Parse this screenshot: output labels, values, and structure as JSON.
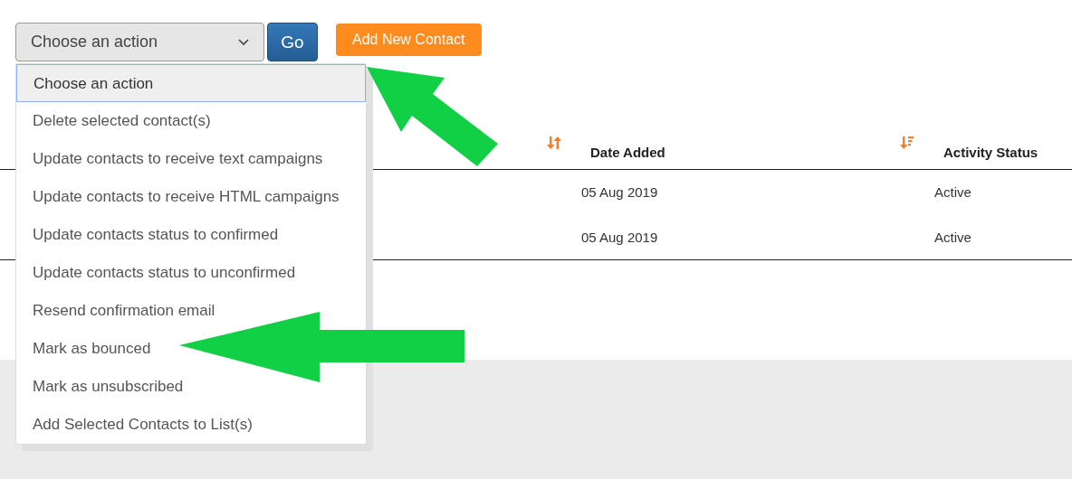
{
  "toolbar": {
    "action_select": {
      "value": "Choose an action",
      "expanded": true,
      "options": [
        {
          "label": "Choose an action",
          "selected": true
        },
        {
          "label": "Delete selected contact(s)",
          "selected": false
        },
        {
          "label": "Update contacts to receive text campaigns",
          "selected": false
        },
        {
          "label": "Update contacts to receive HTML campaigns",
          "selected": false
        },
        {
          "label": "Update contacts status to confirmed",
          "selected": false
        },
        {
          "label": "Update contacts status to unconfirmed",
          "selected": false
        },
        {
          "label": "Resend confirmation email",
          "selected": false
        },
        {
          "label": "Mark as bounced",
          "selected": false
        },
        {
          "label": "Mark as unsubscribed",
          "selected": false
        },
        {
          "label": "Add Selected Contacts to List(s)",
          "selected": false
        }
      ]
    },
    "go_button": "Go",
    "add_button": "Add New Contact"
  },
  "table": {
    "columns": [
      {
        "label": "Date Added",
        "sort_descending": false
      },
      {
        "label": "Activity Status",
        "sort_descending": true
      }
    ],
    "rows": [
      [
        "05 Aug 2019",
        "Active"
      ],
      [
        "05 Aug 2019",
        "Active"
      ]
    ]
  }
}
